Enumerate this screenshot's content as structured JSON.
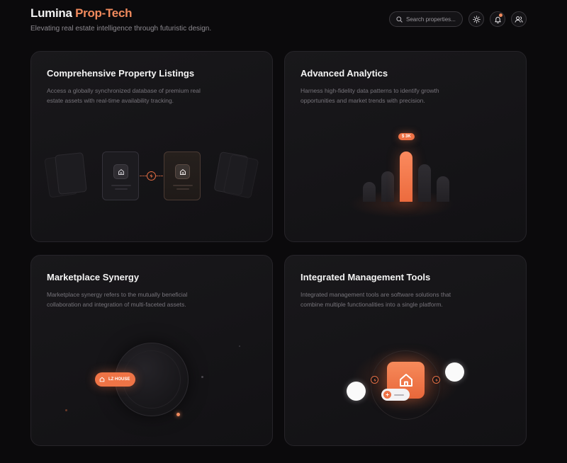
{
  "header": {
    "brand_main": "Lumina",
    "brand_accent": "Prop-Tech",
    "tagline": "Elevating real estate intelligence through futuristic design."
  },
  "toolbar": {
    "search_placeholder": "Search properties...",
    "icons": [
      "search-icon",
      "sun-icon",
      "bell-icon",
      "users-icon"
    ],
    "notification_dot_color": "#f08a5d"
  },
  "cards": [
    {
      "title": "Comprehensive Property Listings",
      "description": "Access a globally synchronized database of premium real estate assets with real-time availability tracking."
    },
    {
      "title": "Advanced Analytics",
      "description": "Harness high-fidelity data patterns to identify growth opportunities and market trends with precision.",
      "chart_tag": "$ 3K"
    },
    {
      "title": "Marketplace Synergy",
      "description": "Marketplace synergy refers to the mutually beneficial collaboration and integration of multi-faceted assets.",
      "pill_label": "LZ HOUSE"
    },
    {
      "title": "Integrated Management Tools",
      "description": "Integrated management tools are software solutions that combine multiple functionalities into a single platform."
    }
  ],
  "colors": {
    "accent": "#f08a5d",
    "background": "#0b0a0c",
    "card": "#161518"
  }
}
